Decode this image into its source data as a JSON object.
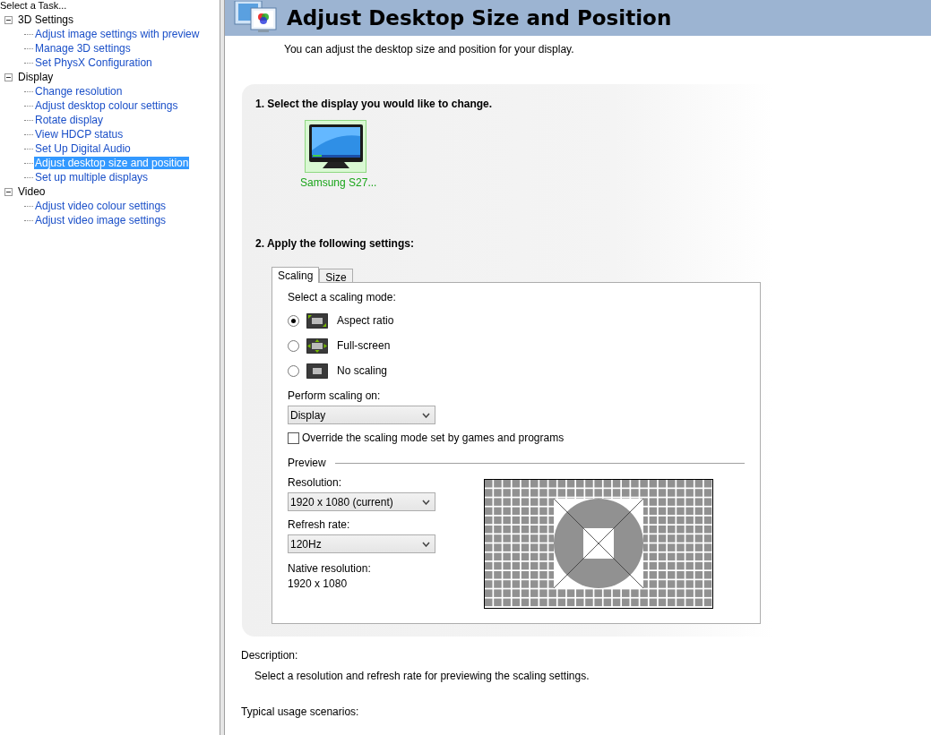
{
  "sidebar": {
    "header": "Select a Task...",
    "tree": [
      {
        "label": "3D Settings",
        "expanded": true,
        "children": [
          {
            "label": "Adjust image settings with preview",
            "selected": false
          },
          {
            "label": "Manage 3D settings",
            "selected": false
          },
          {
            "label": "Set PhysX Configuration",
            "selected": false
          }
        ]
      },
      {
        "label": "Display",
        "expanded": true,
        "children": [
          {
            "label": "Change resolution",
            "selected": false
          },
          {
            "label": "Adjust desktop colour settings",
            "selected": false
          },
          {
            "label": "Rotate display",
            "selected": false
          },
          {
            "label": "View HDCP status",
            "selected": false
          },
          {
            "label": "Set Up Digital Audio",
            "selected": false
          },
          {
            "label": "Adjust desktop size and position",
            "selected": true
          },
          {
            "label": "Set up multiple displays",
            "selected": false
          }
        ]
      },
      {
        "label": "Video",
        "expanded": true,
        "children": [
          {
            "label": "Adjust video colour settings",
            "selected": false
          },
          {
            "label": "Adjust video image settings",
            "selected": false
          }
        ]
      }
    ]
  },
  "page": {
    "title": "Adjust Desktop Size and Position",
    "subtitle": "You can adjust the desktop size and position for your display.",
    "step1": "1. Select the display you would like to change.",
    "displays": [
      {
        "name": "Samsung S27...",
        "selected": true
      }
    ],
    "step2": "2. Apply the following settings:",
    "tabs": [
      {
        "label": "Scaling",
        "selected": true
      },
      {
        "label": "Size",
        "selected": false
      }
    ],
    "scaling_label": "Select a scaling mode:",
    "modes": [
      {
        "kind": "aspect",
        "label": "Aspect ratio",
        "selected": true
      },
      {
        "kind": "fullscreen",
        "label": "Full-screen",
        "selected": false
      },
      {
        "kind": "none",
        "label": "No scaling",
        "selected": false
      }
    ],
    "perform_label": "Perform scaling on:",
    "perform_value": "Display",
    "override": {
      "label": "Override the scaling mode set by games and programs",
      "checked": false
    },
    "preview_label": "Preview",
    "resolution_label": "Resolution:",
    "resolution_value": "1920 x 1080 (current)",
    "refresh_label": "Refresh rate:",
    "refresh_value": "120Hz",
    "native_label": "Native resolution:",
    "native_value": "1920 x 1080"
  },
  "description": {
    "label": "Description:",
    "text": "Select a resolution and refresh rate for previewing the scaling settings."
  },
  "typical_label": "Typical usage scenarios:"
}
